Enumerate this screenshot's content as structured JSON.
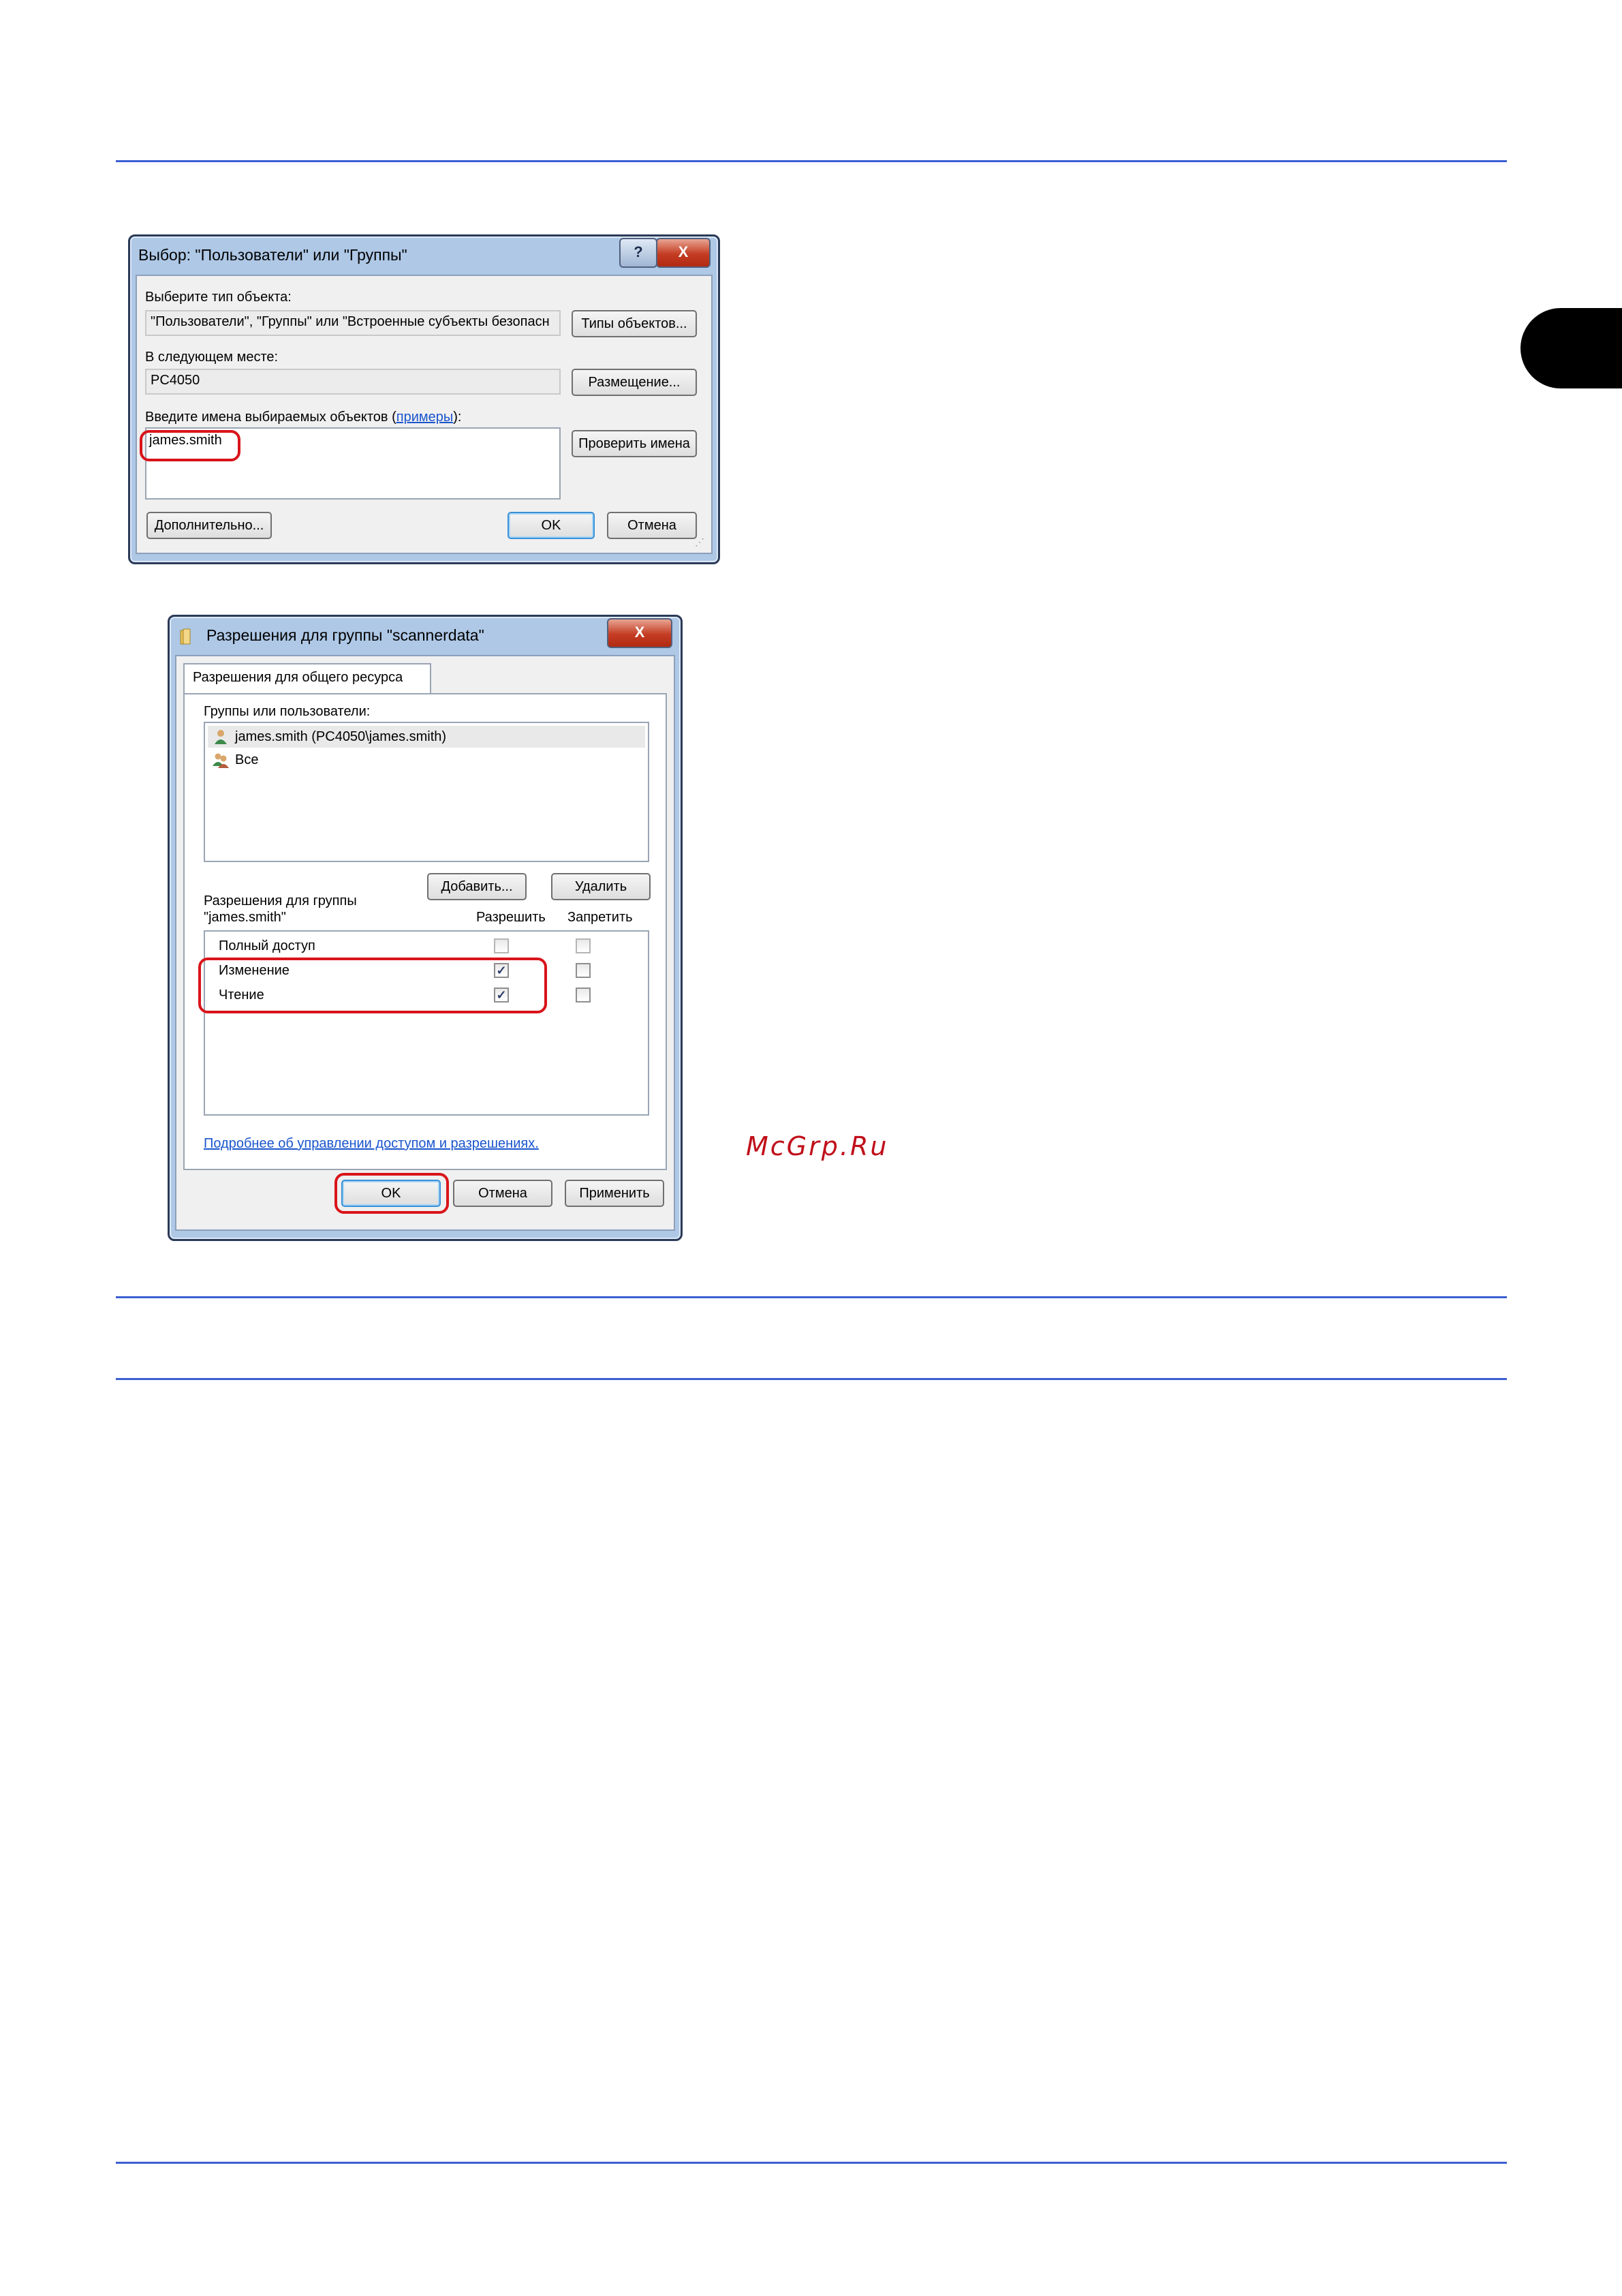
{
  "page": {
    "watermark": "McGrp.Ru",
    "colors": {
      "rule": "#3c5fd3",
      "highlight": "#d9141a",
      "link": "#1a55cc",
      "tab_marker": "#000000"
    }
  },
  "dialog_select": {
    "title": "Выбор: \"Пользователи\" или \"Группы\"",
    "help_symbol": "?",
    "close_symbol": "X",
    "object_type_label": "Выберите тип объекта:",
    "object_type_value": "\"Пользователи\", \"Группы\" или \"Встроенные субъекты безопасн",
    "object_types_button": "Типы объектов...",
    "location_label": "В следующем месте:",
    "location_value": "PC4050",
    "locations_button": "Размещение...",
    "names_label_prefix": "Введите имена выбираемых объектов (",
    "names_label_link": "примеры",
    "names_label_suffix": "):",
    "names_value": "james.smith",
    "check_names_button": "Проверить имена",
    "advanced_button": "Дополнительно...",
    "ok_button": "OK",
    "cancel_button": "Отмена"
  },
  "dialog_permissions": {
    "title": "Разрешения для группы \"scannerdata\"",
    "close_symbol": "X",
    "tab_label": "Разрешения для общего ресурса",
    "groups_label": "Группы или пользователи:",
    "users": [
      {
        "name": "james.smith (PC4050\\james.smith)",
        "icon": "user-icon",
        "selected": true
      },
      {
        "name": "Все",
        "icon": "users-group-icon",
        "selected": false
      }
    ],
    "add_button": "Добавить...",
    "remove_button": "Удалить",
    "perm_label_line1": "Разрешения для группы",
    "perm_label_line2": "\"james.smith\"",
    "allow_header": "Разрешить",
    "deny_header": "Запретить",
    "permissions": [
      {
        "name": "Полный доступ",
        "allow": false,
        "deny": false
      },
      {
        "name": "Изменение",
        "allow": true,
        "deny": false
      },
      {
        "name": "Чтение",
        "allow": true,
        "deny": false
      }
    ],
    "help_link": "Подробнее об управлении доступом и разрешениях.",
    "ok_button": "OK",
    "cancel_button": "Отмена",
    "apply_button": "Применить"
  }
}
